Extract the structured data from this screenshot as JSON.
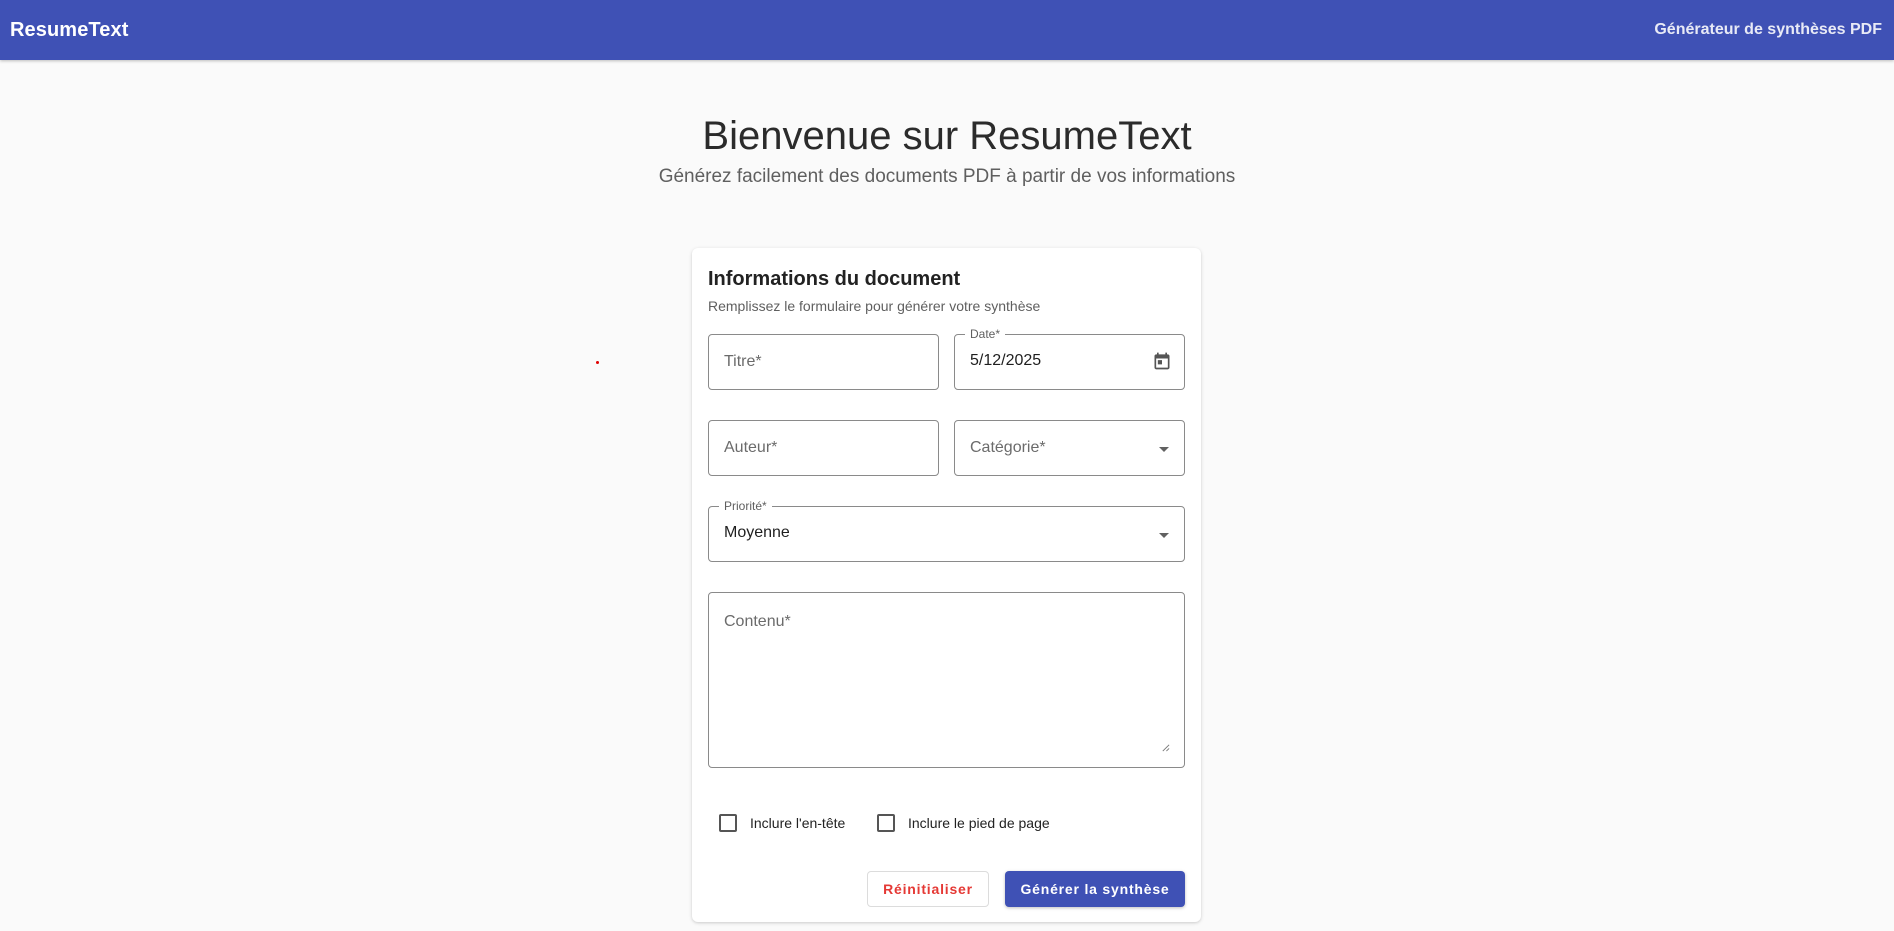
{
  "appbar": {
    "brand": "ResumeText",
    "subtitle": "Générateur de synthèses PDF"
  },
  "hero": {
    "title": "Bienvenue sur ResumeText",
    "subtitle": "Générez facilement des documents PDF à partir de vos informations"
  },
  "card": {
    "title": "Informations du document",
    "subtitle": "Remplissez le formulaire pour générer votre synthèse"
  },
  "form": {
    "titre": {
      "placeholder": "Titre*",
      "value": ""
    },
    "date": {
      "label": "Date*",
      "value": "5/12/2025",
      "icon": "calendar-icon"
    },
    "auteur": {
      "placeholder": "Auteur*",
      "value": ""
    },
    "categorie": {
      "placeholder": "Catégorie*",
      "value": "",
      "icon": "chevron-down-icon"
    },
    "priorite": {
      "label": "Priorité*",
      "value": "Moyenne",
      "icon": "chevron-down-icon"
    },
    "contenu": {
      "placeholder": "Contenu*",
      "value": ""
    },
    "checkboxes": [
      {
        "label": "Inclure l'en-tête",
        "checked": false
      },
      {
        "label": "Inclure le pied de page",
        "checked": false
      }
    ]
  },
  "buttons": {
    "reset": "Réinitialiser",
    "generate": "Générer la synthèse"
  },
  "colors": {
    "primary": "#3f51b5",
    "reset_text": "#e53935",
    "background": "#fafafa"
  }
}
